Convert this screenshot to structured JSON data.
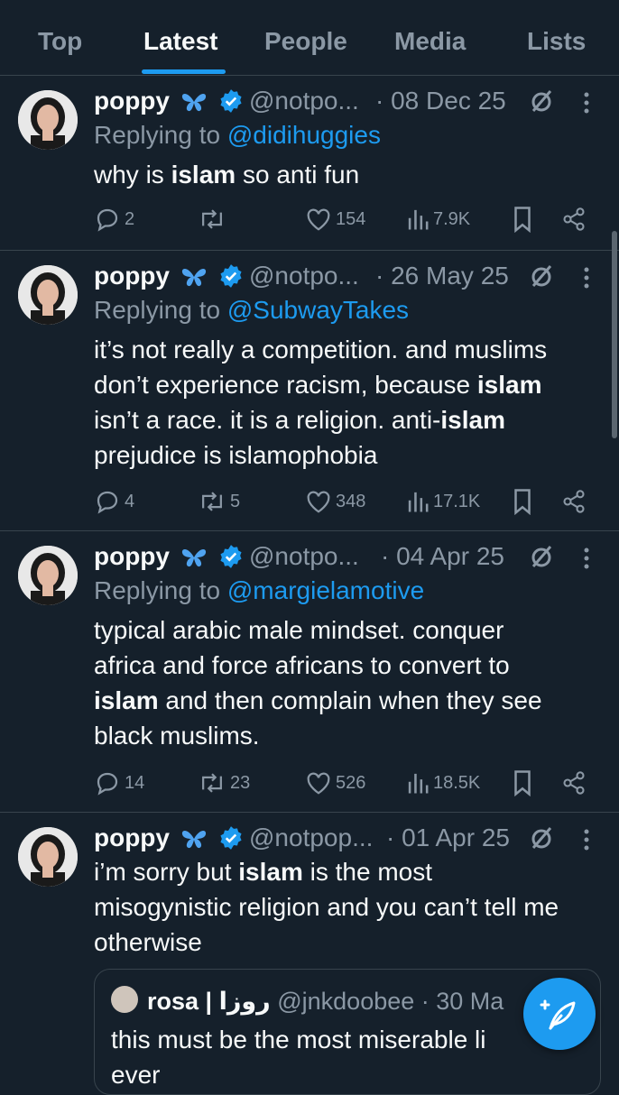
{
  "tabs": [
    {
      "label": "Top"
    },
    {
      "label": "Latest",
      "active": true
    },
    {
      "label": "People"
    },
    {
      "label": "Media"
    },
    {
      "label": "Lists"
    }
  ],
  "colors": {
    "background": "#15202b",
    "accent": "#1d9bf0",
    "muted": "#8b98a5"
  },
  "tweets": [
    {
      "name": "poppy",
      "emoji": "butterfly",
      "handle": "@notpo...",
      "date": "· 08 Dec 25",
      "replying_prefix": "Replying to ",
      "replying_to": "@didihuggies",
      "lines": [
        [
          "why is ",
          "islam",
          " so anti fun"
        ]
      ],
      "replies": "2",
      "retweets": "",
      "likes": "154",
      "views": "7.9K"
    },
    {
      "name": "poppy",
      "emoji": "butterfly",
      "handle": "@notpo...",
      "date": "· 26 May 25",
      "replying_prefix": "Replying to ",
      "replying_to": "@SubwayTakes",
      "lines": [
        [
          "it’s not really a competition. and muslims",
          "",
          ""
        ],
        [
          "don’t experience racism, because ",
          "islam",
          ""
        ],
        [
          "isn’t a race. it is a religion. anti-",
          "islam",
          ""
        ],
        [
          "prejudice is islamophobia",
          "",
          ""
        ]
      ],
      "replies": "4",
      "retweets": "5",
      "likes": "348",
      "views": "17.1K"
    },
    {
      "name": "poppy",
      "emoji": "butterfly",
      "handle": "@notpo...",
      "date": "· 04 Apr 25",
      "replying_prefix": "Replying to ",
      "replying_to": "@margielamotive",
      "lines": [
        [
          "typical arabic male mindset. conquer",
          "",
          ""
        ],
        [
          "africa and force africans to convert to",
          "",
          ""
        ],
        [
          "",
          "islam",
          " and then complain when they see"
        ],
        [
          "black muslims.",
          "",
          ""
        ]
      ],
      "replies": "14",
      "retweets": "23",
      "likes": "526",
      "views": "18.5K"
    },
    {
      "name": "poppy",
      "emoji": "butterfly",
      "handle": "@notpop...",
      "date": "· 01 Apr 25",
      "lines": [
        [
          "i’m sorry but ",
          "islam",
          " is the most"
        ],
        [
          "misogynistic religion  and you can’t tell me",
          "",
          ""
        ],
        [
          "otherwise",
          "",
          ""
        ]
      ],
      "quote": {
        "name": "rosa | روزا",
        "handle": "@jnkdoobee",
        "date": "· 30 Ma",
        "text_line1": "this must be the most miserable li",
        "text_line2": "ever"
      }
    }
  ]
}
